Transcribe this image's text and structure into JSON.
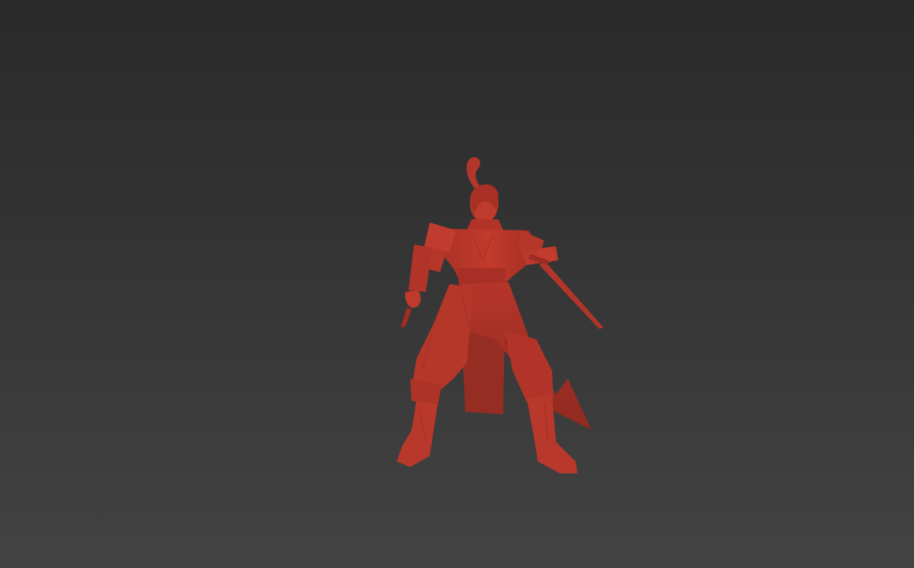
{
  "viewport": {
    "background_top": "#2a2a2a",
    "background_bottom": "#434343"
  },
  "model": {
    "subject": "warrior-with-sword",
    "shading_color": "#c0392b",
    "shadow_color": "#8e2a20",
    "highlight_color": "#d9503f"
  }
}
